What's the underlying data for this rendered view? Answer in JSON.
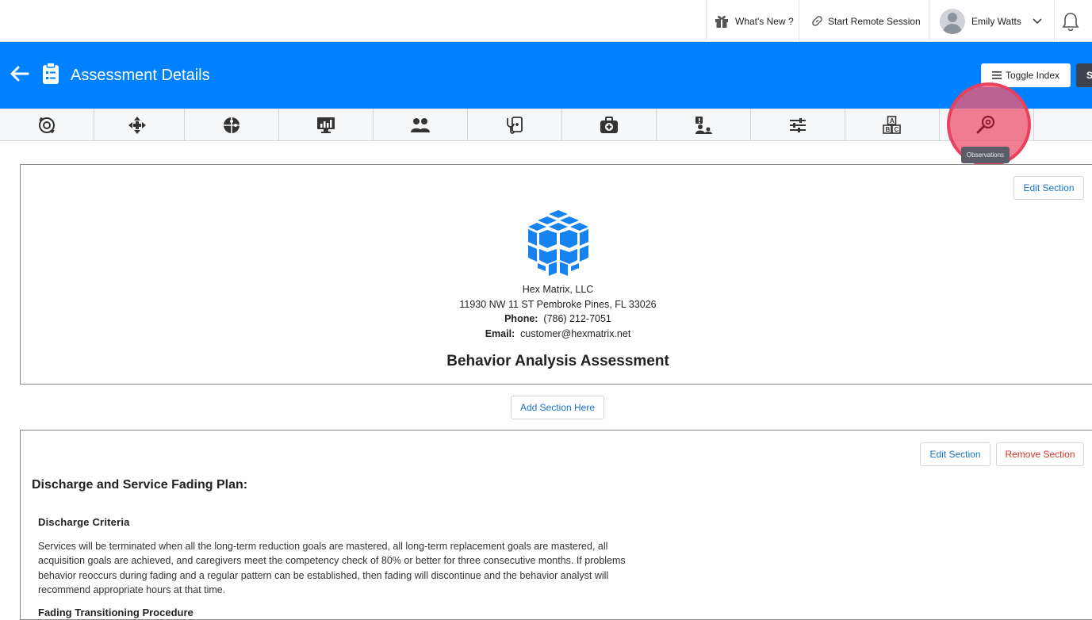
{
  "topbar": {
    "whats_new": "What's New ?",
    "remote_session": "Start Remote Session",
    "user_name": "Emily Watts"
  },
  "header": {
    "title": "Assessment Details",
    "toggle_index": "Toggle Index",
    "dark_button": "S"
  },
  "toolbar": {
    "icons": [
      "target-refresh-icon",
      "move-arrows-icon",
      "puzzle-icon",
      "monitor-chart-icon",
      "users-icon",
      "stethoscope-icon",
      "medical-kit-icon",
      "user-alert-icon",
      "sliders-icon",
      "abc-blocks-icon",
      "observations-search-icon",
      "pen-icon"
    ],
    "tooltip": "Observations"
  },
  "card1": {
    "edit_label": "Edit Section",
    "company": "Hex Matrix, LLC",
    "address": "11930 NW 11 ST Pembroke Pines, FL 33026",
    "phone_label": "Phone:",
    "phone": "(786) 212-7051",
    "email_label": "Email:",
    "email": "customer@hexmatrix.net",
    "title": "Behavior Analysis Assessment"
  },
  "add_section": "Add Section Here",
  "card2": {
    "edit_label": "Edit Section",
    "remove_label": "Remove Section",
    "title": "Discharge and Service Fading Plan:",
    "criteria_title": "Discharge Criteria",
    "criteria_text": "Services will be terminated when all the long-term reduction goals are mastered, all long-term replacement goals are mastered, all acquisition goals are achieved, and caregivers meet the competency check of 80% or better for three consecutive months. If problems behavior reoccurs during fading and a regular pattern can be established, then fading will discontinue and the behavior analyst will recommend appropriate hours at that time.",
    "next_title": "Fading Transitioning Procedure"
  },
  "colors": {
    "primary": "#0081ff",
    "highlight": "#e8415e",
    "danger": "#d9342b",
    "link": "#1a73c8"
  }
}
